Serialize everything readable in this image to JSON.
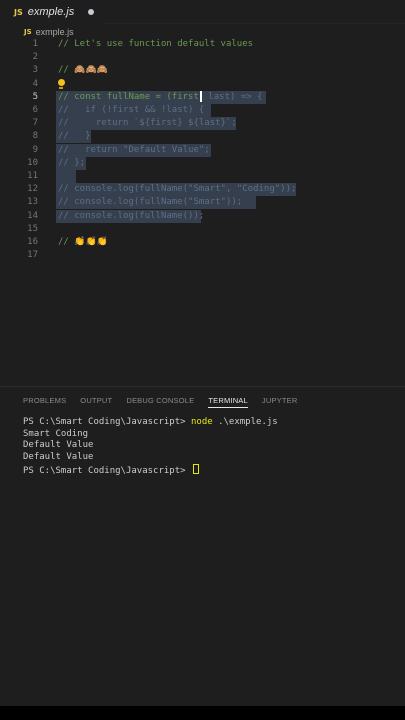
{
  "tab": {
    "icon": "JS",
    "filename": "exmple.js"
  },
  "breadcrumb": {
    "icon": "JS",
    "filename": "exmple.js"
  },
  "editor": {
    "lines": [
      {
        "n": "1",
        "text": "// Let's use function default values",
        "selected": false
      },
      {
        "n": "2",
        "text": "",
        "selected": false
      },
      {
        "n": "3",
        "text": "// 🙈🙈🙈",
        "selected": false
      },
      {
        "n": "4",
        "text": "",
        "selected": false,
        "lightbulb": true
      },
      {
        "n": "5",
        "text_before": "// const fullName = (first",
        "text_after": " last) => {",
        "selected": true,
        "active": true
      },
      {
        "n": "6",
        "text": "//   if (!first && !last) {",
        "selected": true
      },
      {
        "n": "7",
        "text": "//     return `${first} ${last}`;",
        "selected": true
      },
      {
        "n": "8",
        "text": "//   }",
        "selected": true
      },
      {
        "n": "9",
        "text": "//   return \"Default Value\";",
        "selected": true
      },
      {
        "n": "10",
        "text": "// };",
        "selected": true
      },
      {
        "n": "11",
        "text": "",
        "selected": true
      },
      {
        "n": "12",
        "text": "// console.log(fullName(\"Smart\", \"Coding\"));",
        "selected": true
      },
      {
        "n": "13",
        "text": "// console.log(fullName(\"Smart\"));",
        "selected": true
      },
      {
        "n": "14",
        "text": "// console.log(fullName());",
        "selected": true
      },
      {
        "n": "15",
        "text": "",
        "selected": false
      },
      {
        "n": "16",
        "text": "// 👏👏👏",
        "selected": false
      },
      {
        "n": "17",
        "text": "",
        "selected": false
      }
    ]
  },
  "panel": {
    "tabs": [
      "PROBLEMS",
      "OUTPUT",
      "DEBUG CONSOLE",
      "TERMINAL",
      "JUPYTER"
    ],
    "active_tab": "TERMINAL"
  },
  "terminal": {
    "prompt": "PS C:\\Smart Coding\\Javascript> ",
    "command": "node",
    "args": " .\\exmple.js",
    "output": [
      "Smart Coding",
      "Default Value",
      "Default Value"
    ],
    "prompt2": "PS C:\\Smart Coding\\Javascript> "
  },
  "colors": {
    "background": "#1e1e1e",
    "comment": "#6a9955",
    "selection": "#3a4557",
    "terminal_command": "#e5e510"
  }
}
